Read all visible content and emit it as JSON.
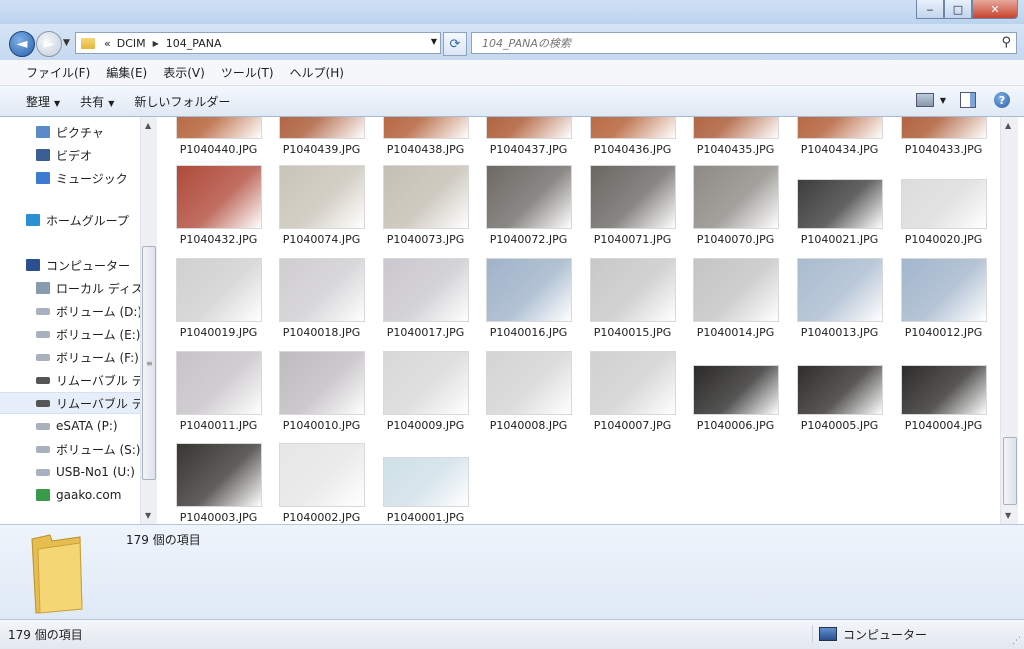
{
  "window": {
    "minimize": "‒",
    "maximize": "□",
    "close": "✕"
  },
  "address": {
    "prefix": "«",
    "crumbs": [
      "DCIM",
      "104_PANA"
    ],
    "search_placeholder": "104_PANAの検索"
  },
  "menu": [
    "ファイル(F)",
    "編集(E)",
    "表示(V)",
    "ツール(T)",
    "ヘルプ(H)"
  ],
  "toolbar": {
    "organize": "整理",
    "share": "共有",
    "new_folder": "新しいフォルダー"
  },
  "sidebar": {
    "items": [
      {
        "label": "ピクチャ",
        "icon": "pictures-icon",
        "indent": 1
      },
      {
        "label": "ビデオ",
        "icon": "videos-icon",
        "indent": 1
      },
      {
        "label": "ミュージック",
        "icon": "music-icon",
        "indent": 1
      },
      {
        "label": "ホームグループ",
        "icon": "homegroup-icon",
        "indent": 0
      },
      {
        "label": "コンピューター",
        "icon": "computer-icon",
        "indent": 0
      },
      {
        "label": "ローカル ディス",
        "icon": "local-disk-icon",
        "indent": 1
      },
      {
        "label": "ボリューム (D:)",
        "icon": "drive-icon",
        "indent": 1
      },
      {
        "label": "ボリューム (E:)",
        "icon": "drive-icon",
        "indent": 1
      },
      {
        "label": "ボリューム (F:)",
        "icon": "drive-icon",
        "indent": 1
      },
      {
        "label": "リムーバブル デ",
        "icon": "removable-drive-icon",
        "indent": 1
      },
      {
        "label": "リムーバブル デ",
        "icon": "removable-drive-icon",
        "indent": 1,
        "selected": true
      },
      {
        "label": "eSATA (P:)",
        "icon": "drive-icon",
        "indent": 1
      },
      {
        "label": "ボリューム (S:)",
        "icon": "drive-icon",
        "indent": 1
      },
      {
        "label": "USB-No1 (U:)",
        "icon": "drive-icon",
        "indent": 1
      },
      {
        "label": "gaako.com",
        "icon": "network-icon",
        "indent": 1
      }
    ]
  },
  "files": [
    {
      "name": "P1040440.JPG",
      "tone": "#b25a2e"
    },
    {
      "name": "P1040439.JPG",
      "tone": "#a85530"
    },
    {
      "name": "P1040438.JPG",
      "tone": "#b0582f"
    },
    {
      "name": "P1040437.JPG",
      "tone": "#a9532b"
    },
    {
      "name": "P1040436.JPG",
      "tone": "#b25a2e"
    },
    {
      "name": "P1040435.JPG",
      "tone": "#a85530"
    },
    {
      "name": "P1040434.JPG",
      "tone": "#b0582f"
    },
    {
      "name": "P1040433.JPG",
      "tone": "#a9532b"
    },
    {
      "name": "P1040432.JPG",
      "tone": "#b04a3a"
    },
    {
      "name": "P1040074.JPG",
      "tone": "#c9c4b8"
    },
    {
      "name": "P1040073.JPG",
      "tone": "#c4bfb3"
    },
    {
      "name": "P1040072.JPG",
      "tone": "#6d6a66"
    },
    {
      "name": "P1040071.JPG",
      "tone": "#6a6763"
    },
    {
      "name": "P1040070.JPG",
      "tone": "#8d8a85"
    },
    {
      "name": "P1040021.JPG",
      "tone": "#3d3d3d"
    },
    {
      "name": "P1040020.JPG",
      "tone": "#dcdcdc"
    },
    {
      "name": "P1040019.JPG",
      "tone": "#d0d0d0"
    },
    {
      "name": "P1040018.JPG",
      "tone": "#cfcdd0"
    },
    {
      "name": "P1040017.JPG",
      "tone": "#cac8cc"
    },
    {
      "name": "P1040016.JPG",
      "tone": "#9fb3c9"
    },
    {
      "name": "P1040015.JPG",
      "tone": "#c8c8c8"
    },
    {
      "name": "P1040014.JPG",
      "tone": "#c4c4c4"
    },
    {
      "name": "P1040013.JPG",
      "tone": "#a9bbcf"
    },
    {
      "name": "P1040012.JPG",
      "tone": "#a3b6cc"
    },
    {
      "name": "P1040011.JPG",
      "tone": "#c6c3c6"
    },
    {
      "name": "P1040010.JPG",
      "tone": "#bfbcbf"
    },
    {
      "name": "P1040009.JPG",
      "tone": "#d8d8d8"
    },
    {
      "name": "P1040008.JPG",
      "tone": "#d4d4d4"
    },
    {
      "name": "P1040007.JPG",
      "tone": "#d0d0d0"
    },
    {
      "name": "P1040006.JPG",
      "tone": "#2b2a29"
    },
    {
      "name": "P1040005.JPG",
      "tone": "#2f2e2c"
    },
    {
      "name": "P1040004.JPG",
      "tone": "#2d2c2a"
    },
    {
      "name": "P1040003.JPG",
      "tone": "#383633"
    },
    {
      "name": "P1040002.JPG",
      "tone": "#e6e6e6"
    },
    {
      "name": "P1040001.JPG",
      "tone": "#cfe0e8"
    }
  ],
  "details": {
    "count_text": "179 個の項目"
  },
  "status": {
    "left": "179 個の項目",
    "right": "コンピューター"
  }
}
